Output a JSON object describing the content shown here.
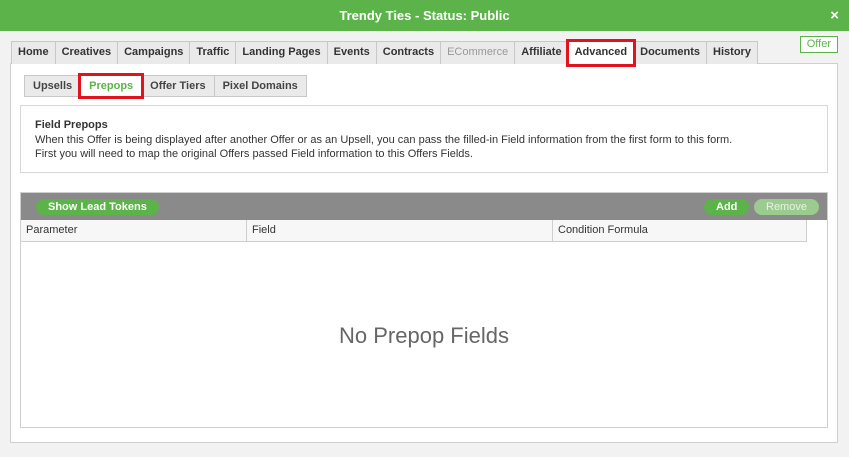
{
  "window": {
    "title": "Trendy Ties - Status: Public",
    "close_icon": "×"
  },
  "badge": {
    "label": "Offer"
  },
  "tabs": [
    {
      "label": "Home"
    },
    {
      "label": "Creatives"
    },
    {
      "label": "Campaigns"
    },
    {
      "label": "Traffic"
    },
    {
      "label": "Landing Pages"
    },
    {
      "label": "Events"
    },
    {
      "label": "Contracts"
    },
    {
      "label": "ECommerce"
    },
    {
      "label": "Affiliate"
    },
    {
      "label": "Advanced"
    },
    {
      "label": "Documents"
    },
    {
      "label": "History"
    }
  ],
  "subtabs": [
    {
      "label": "Upsells"
    },
    {
      "label": "Prepops"
    },
    {
      "label": "Offer Tiers"
    },
    {
      "label": "Pixel Domains"
    }
  ],
  "info": {
    "heading": "Field Prepops",
    "line1": "When this Offer is being displayed after another Offer or as an Upsell, you can pass the filled-in Field information from the first form to this form.",
    "line2": "First you will need to map the original Offers passed Field information to this Offers Fields."
  },
  "grid": {
    "show_lead_tokens_label": "Show Lead Tokens",
    "add_label": "Add",
    "remove_label": "Remove",
    "columns": [
      "Parameter",
      "Field",
      "Condition Formula"
    ],
    "empty_text": "No Prepop Fields"
  },
  "colors": {
    "brand_green": "#5cb34a",
    "highlight_red": "#e0131e",
    "toolbar_gray": "#8a8a8a"
  }
}
